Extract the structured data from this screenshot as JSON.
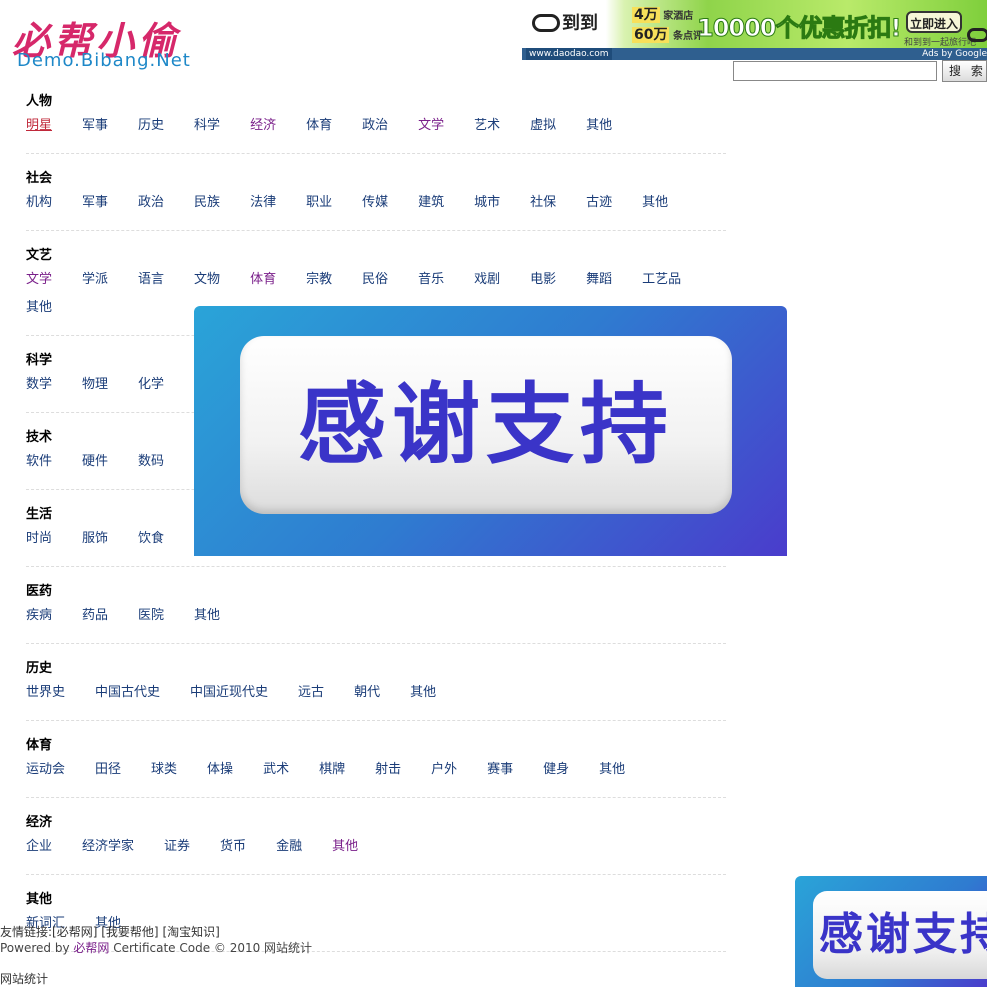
{
  "logo": {
    "cn": "必帮小偷",
    "en": "Demo.Bibang.Net"
  },
  "ad": {
    "brand": "到到",
    "line1_num": "4万",
    "line1_text": "家酒店",
    "line2_num": "60万",
    "line2_text": "条点评",
    "headline": "10000个优惠折扣!",
    "button": "立即进入",
    "tagline": "和到到一起旅行吧",
    "url": "www.daodao.com",
    "google": "Ads by Google"
  },
  "search": {
    "placeholder": "",
    "button": "搜 索"
  },
  "categories": [
    {
      "title": "人物",
      "links": [
        {
          "text": "明星",
          "state": "active"
        },
        {
          "text": "军事"
        },
        {
          "text": "历史"
        },
        {
          "text": "科学"
        },
        {
          "text": "经济",
          "state": "visited"
        },
        {
          "text": "体育"
        },
        {
          "text": "政治"
        },
        {
          "text": "文学",
          "state": "visited"
        },
        {
          "text": "艺术"
        },
        {
          "text": "虚拟"
        },
        {
          "text": "其他"
        }
      ]
    },
    {
      "title": "社会",
      "links": [
        {
          "text": "机构"
        },
        {
          "text": "军事"
        },
        {
          "text": "政治"
        },
        {
          "text": "民族"
        },
        {
          "text": "法律"
        },
        {
          "text": "职业"
        },
        {
          "text": "传媒"
        },
        {
          "text": "建筑"
        },
        {
          "text": "城市"
        },
        {
          "text": "社保"
        },
        {
          "text": "古迹"
        },
        {
          "text": "其他"
        }
      ]
    },
    {
      "title": "文艺",
      "links": [
        {
          "text": "文学",
          "state": "visited"
        },
        {
          "text": "学派"
        },
        {
          "text": "语言"
        },
        {
          "text": "文物"
        },
        {
          "text": "体育",
          "state": "visited"
        },
        {
          "text": "宗教"
        },
        {
          "text": "民俗"
        },
        {
          "text": "音乐"
        },
        {
          "text": "戏剧"
        },
        {
          "text": "电影"
        },
        {
          "text": "舞蹈"
        },
        {
          "text": "工艺品"
        },
        {
          "text": "其他"
        }
      ]
    },
    {
      "title": "科学",
      "links": [
        {
          "text": "数学"
        },
        {
          "text": "物理"
        },
        {
          "text": "化学"
        }
      ]
    },
    {
      "title": "技术",
      "links": [
        {
          "text": "软件"
        },
        {
          "text": "硬件"
        },
        {
          "text": "数码"
        }
      ]
    },
    {
      "title": "生活",
      "links": [
        {
          "text": "时尚"
        },
        {
          "text": "服饰"
        },
        {
          "text": "饮食"
        }
      ]
    },
    {
      "title": "医药",
      "links": [
        {
          "text": "疾病"
        },
        {
          "text": "药品"
        },
        {
          "text": "医院"
        },
        {
          "text": "其他"
        }
      ]
    },
    {
      "title": "历史",
      "links": [
        {
          "text": "世界史"
        },
        {
          "text": "中国古代史"
        },
        {
          "text": "中国近现代史"
        },
        {
          "text": "远古"
        },
        {
          "text": "朝代"
        },
        {
          "text": "其他"
        }
      ]
    },
    {
      "title": "体育",
      "links": [
        {
          "text": "运动会"
        },
        {
          "text": "田径"
        },
        {
          "text": "球类"
        },
        {
          "text": "体操"
        },
        {
          "text": "武术"
        },
        {
          "text": "棋牌"
        },
        {
          "text": "射击"
        },
        {
          "text": "户外"
        },
        {
          "text": "赛事"
        },
        {
          "text": "健身"
        },
        {
          "text": "其他"
        }
      ]
    },
    {
      "title": "经济",
      "links": [
        {
          "text": "企业"
        },
        {
          "text": "经济学家"
        },
        {
          "text": "证券"
        },
        {
          "text": "货币"
        },
        {
          "text": "金融"
        },
        {
          "text": "其他",
          "state": "visited"
        }
      ]
    },
    {
      "title": "其他",
      "links": [
        {
          "text": "新词汇"
        },
        {
          "text": "其他"
        }
      ]
    }
  ],
  "overlay": {
    "text": "感谢支持"
  },
  "corner": {
    "text": "感谢支持"
  },
  "footer": {
    "friend_prefix": "友情链接:",
    "friend_links": [
      "[必帮网]",
      "[我要帮他]",
      "[淘宝知识]"
    ],
    "powered_prefix": "Powered by ",
    "powered_brand": "必帮网",
    "powered_suffix": " Certificate Code © 2010 网站统计",
    "stats": "网站统计"
  }
}
